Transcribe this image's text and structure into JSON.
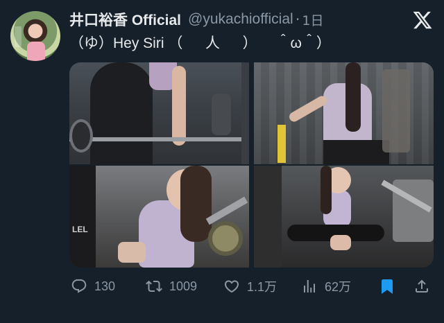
{
  "post": {
    "display_name": "井口裕香 Official",
    "handle": "@yukachiofficial",
    "separator": "·",
    "age": "1日",
    "text": "（ゆ）Hey Siri （ 　 人 　 ） 　＾ω＾）",
    "avatar_label": "井口裕香"
  },
  "media": {
    "count": 4,
    "photo_badge_text": "LEL"
  },
  "actions": {
    "reply_count": "130",
    "repost_count": "1009",
    "like_count": "1.1万",
    "view_count": "62万",
    "bookmarked": true
  },
  "colors": {
    "background": "#15202b",
    "text_primary": "#e7e9ea",
    "text_secondary": "#8b98a5",
    "accent": "#1d9bf0"
  },
  "icons": {
    "logo": "x-logo-icon",
    "reply": "reply-icon",
    "repost": "repost-icon",
    "like": "heart-icon",
    "views": "views-icon",
    "bookmark": "bookmark-icon",
    "share": "share-icon"
  }
}
